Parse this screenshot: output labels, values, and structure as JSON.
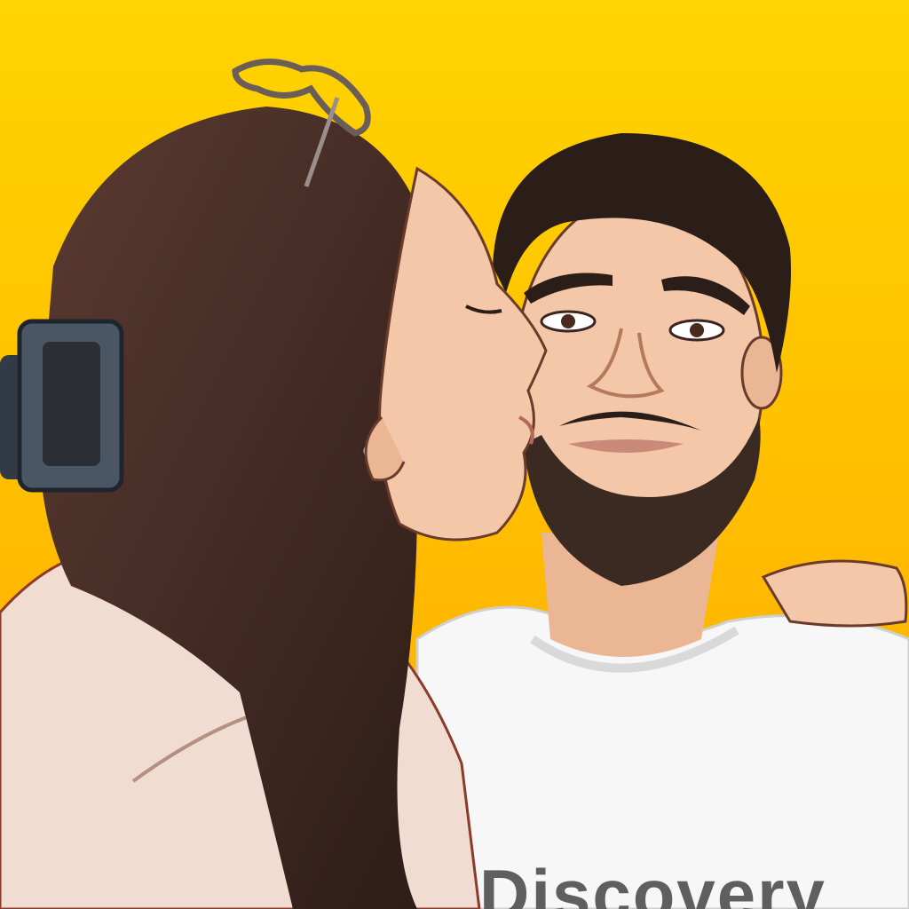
{
  "illustration": {
    "shirt_print": "Discovery",
    "colors": {
      "background_top": "#ffd400",
      "background_bottom": "#ffab00",
      "skin": "#f3c7a7",
      "hair_woman": "#3b2620",
      "hair_man": "#2b1d18",
      "beard": "#3a2a22",
      "man_shirt": "#f7f7f7",
      "woman_blouse": "#f1dcd2",
      "hair_claw_clip": "#4a5663",
      "shirt_print": "#5f5f5f"
    }
  }
}
